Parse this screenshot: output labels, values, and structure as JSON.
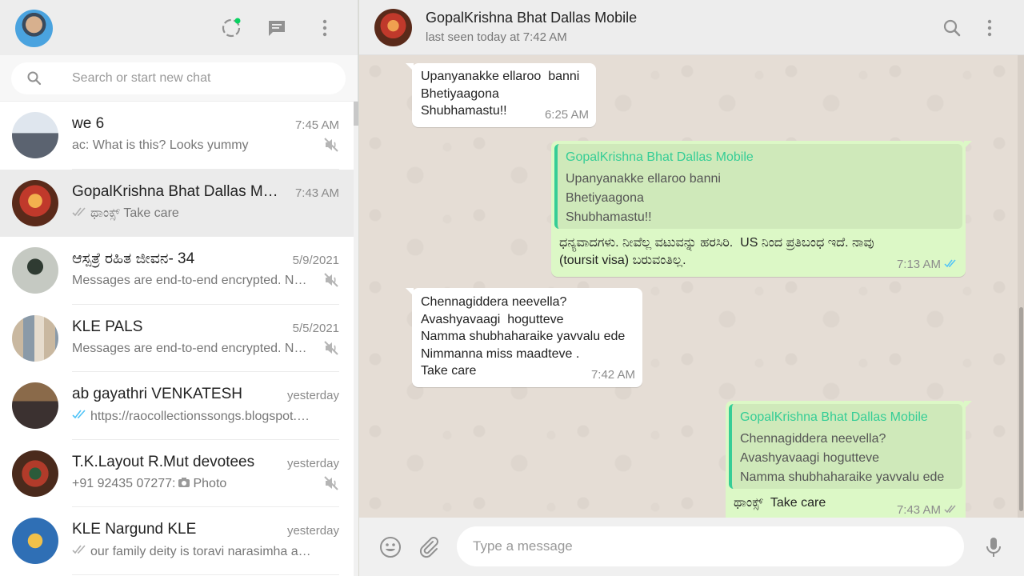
{
  "sidebar": {
    "search": {
      "placeholder": "Search or start new chat"
    },
    "chats": [
      {
        "name": "we 6",
        "time": "7:45 AM",
        "preview": "ac: What is this? Looks yummy",
        "muted": true,
        "ticks": ""
      },
      {
        "name": "GopalKrishna Bhat Dallas Mobile",
        "time": "7:43 AM",
        "preview": "ಥಾಂಕ್ಸ್  Take care",
        "muted": false,
        "ticks": "gray"
      },
      {
        "name": "ಆಸ್ಪತ್ರೆ ರಹಿತ ಜೀವನ- 34",
        "time": "5/9/2021",
        "preview": "Messages are end-to-end encrypted. No one outside of this chat",
        "muted": true,
        "ticks": ""
      },
      {
        "name": "KLE  PALS",
        "time": "5/5/2021",
        "preview": "Messages are end-to-end encrypted. No one outside of this chat",
        "muted": true,
        "ticks": ""
      },
      {
        "name": "ab gayathri VENKATESH",
        "time": "yesterday",
        "preview": "https://raocollectionssongs.blogspot.com",
        "muted": false,
        "ticks": "blue"
      },
      {
        "name": "T.K.Layout R.Mut devotees",
        "time": "yesterday",
        "preview": "+91 92435 07277: ",
        "photo_label": "Photo",
        "muted": true,
        "ticks": ""
      },
      {
        "name": "KLE Nargund KLE",
        "time": "yesterday",
        "preview": "our family deity is toravi narasimha and it is",
        "muted": false,
        "ticks": "gray"
      }
    ]
  },
  "conversation": {
    "contact_name": "GopalKrishna Bhat Dallas Mobile",
    "status": "last seen today at 7:42 AM",
    "messages": [
      {
        "dir": "in",
        "lines": [
          "Upanyanakke ellaroo  banni",
          "Bhetiyaagona",
          "Shubhamastu!!"
        ],
        "time": "6:25 AM"
      },
      {
        "dir": "out",
        "quote_author": "GopalKrishna Bhat Dallas Mobile",
        "quote_lines": [
          "Upanyanakke ellaroo  banni",
          "Bhetiyaagona",
          "Shubhamastu!!"
        ],
        "lines": [
          "ಧನ್ಯವಾದಗಳು. ನೀವೆಲ್ಲ ವಟುವನ್ನು ಹರಸಿರಿ.  US ನಿಂದ ಪ್ರತಿಬಂಧ ಇದೆ. ನಾವು",
          "(toursit visa) ಬರುವಂತಿಲ್ಲ."
        ],
        "time": "7:13 AM",
        "ticks": "blue"
      },
      {
        "dir": "in",
        "lines": [
          "Chennagiddera neevella?",
          "Avashyavaagi  hogutteve",
          "Namma shubhaharaike yavvalu ede",
          "Nimmanna miss maadteve .",
          "Take care"
        ],
        "time": "7:42 AM"
      },
      {
        "dir": "out",
        "quote_author": "GopalKrishna Bhat Dallas Mobile",
        "quote_lines": [
          "Chennagiddera neevella?",
          "Avashyavaagi  hogutteve",
          "Namma shubhaharaike yavvalu ede"
        ],
        "lines": [
          "ಥಾಂಕ್ಸ್  Take care"
        ],
        "time": "7:43 AM",
        "ticks": "gray"
      }
    ]
  },
  "composer": {
    "placeholder": "Type a message"
  },
  "colors": {
    "accent_green": "#35cd96",
    "tick_blue": "#4fc3f7",
    "bubble_out": "#dcf8c6",
    "wallpaper": "#e5ddd5"
  },
  "icons": [
    "status-icon",
    "new-chat-icon",
    "menu-icon",
    "search-icon",
    "mute-icon",
    "double-check-icon",
    "camera-icon",
    "emoji-icon",
    "attach-icon",
    "mic-icon"
  ]
}
